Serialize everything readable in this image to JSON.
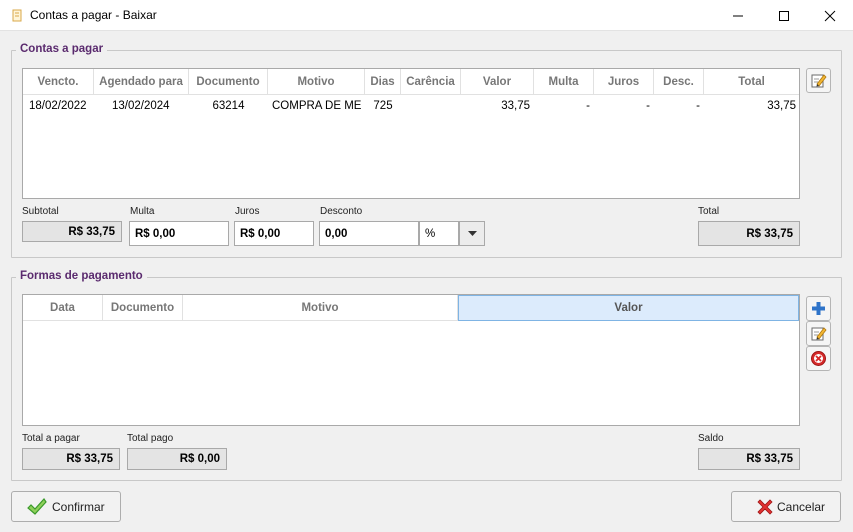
{
  "window": {
    "title": "Contas a pagar - Baixar"
  },
  "contas": {
    "legend": "Contas a pagar",
    "columns": [
      "Vencto.",
      "Agendado para",
      "Documento",
      "Motivo",
      "Dias",
      "Carência",
      "Valor",
      "Multa",
      "Juros",
      "Desc.",
      "Total"
    ],
    "rows": [
      {
        "vencto": "18/02/2022",
        "agendado": "13/02/2024",
        "documento": "63214",
        "motivo": "COMPRA DE MERCADORIAS",
        "dias": "725",
        "carencia": "",
        "valor": "33,75",
        "multa": "-",
        "juros": "-",
        "desc": "-",
        "total": "33,75"
      }
    ],
    "subtotal_label": "Subtotal",
    "subtotal_value": "R$ 33,75",
    "multa_label": "Multa",
    "multa_value": "R$ 0,00",
    "juros_label": "Juros",
    "juros_value": "R$ 0,00",
    "desconto_label": "Desconto",
    "desconto_value": "0,00",
    "desconto_type": "%",
    "total_label": "Total",
    "total_value": "R$ 33,75"
  },
  "formas": {
    "legend": "Formas de pagamento",
    "columns": [
      "Data",
      "Documento",
      "Motivo",
      "Valor"
    ],
    "total_a_pagar_label": "Total a pagar",
    "total_a_pagar_value": "R$ 33,75",
    "total_pago_label": "Total pago",
    "total_pago_value": "R$ 0,00",
    "saldo_label": "Saldo",
    "saldo_value": "R$ 33,75"
  },
  "actions": {
    "confirm_label": "Confirmar",
    "cancel_label": "Cancelar"
  },
  "colors": {
    "accent": "#5a2a6e",
    "selected_header": "#dcebfc",
    "confirm_green": "#3a9a2a",
    "cancel_red": "#d62a2a"
  }
}
